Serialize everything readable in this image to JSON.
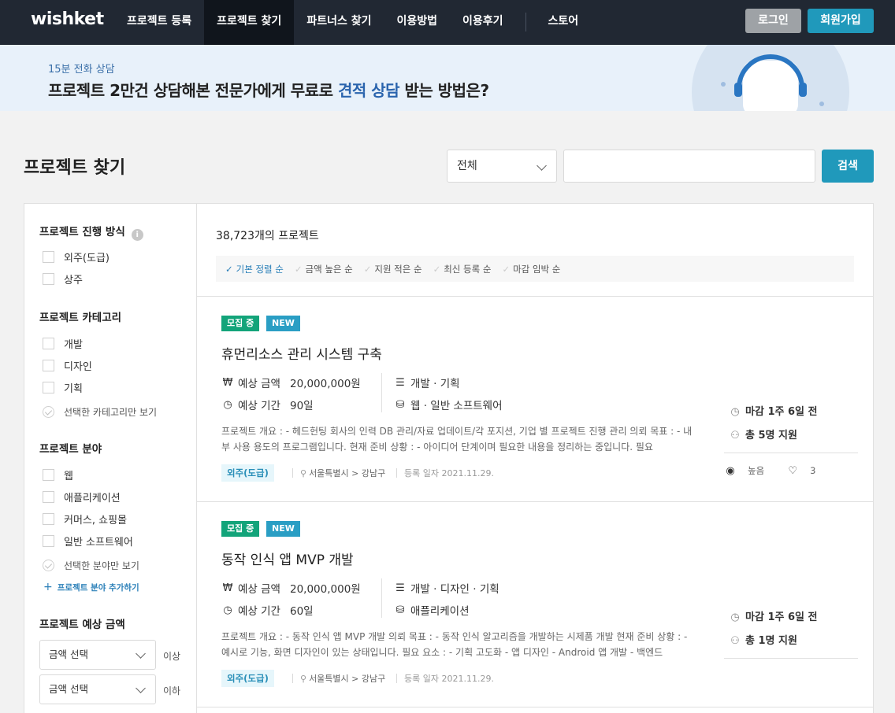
{
  "header": {
    "logo": "wishket",
    "nav": [
      "프로젝트 등록",
      "프로젝트 찾기",
      "파트너스 찾기",
      "이용방법",
      "이용후기",
      "스토어"
    ],
    "login": "로그인",
    "signup": "회원가입"
  },
  "banner": {
    "sub": "15분 전화 상담",
    "title_a": "프로젝트 2만건 상담해본 전문가에게 무료로 ",
    "title_hl": "견적 상담",
    "title_b": " 받는 방법은?"
  },
  "page": {
    "title": "프로젝트 찾기",
    "select_value": "전체",
    "search_placeholder": "",
    "search_button": "검색"
  },
  "sidebar": {
    "progress_title": "프로젝트 진행 방식",
    "progress_options": [
      "외주(도급)",
      "상주"
    ],
    "category_title": "프로젝트 카테고리",
    "category_options": [
      "개발",
      "디자인",
      "기획"
    ],
    "category_only": "선택한 카테고리만 보기",
    "field_title": "프로젝트 분야",
    "field_options": [
      "웹",
      "애플리케이션",
      "커머스, 쇼핑몰",
      "일반 소프트웨어"
    ],
    "field_only": "선택한 분야만 보기",
    "field_add": "프로젝트 분야 추가하기",
    "amount_title": "프로젝트 예상 금액",
    "amount_min": "금액 선택",
    "amount_min_suffix": "이상",
    "amount_max": "금액 선택",
    "amount_max_suffix": "이하"
  },
  "list": {
    "count": "38,723개의 프로젝트",
    "sorts": [
      "기본 정렬 순",
      "금액 높은 순",
      "지원 적은 순",
      "최신 등록 순",
      "마감 임박 순"
    ],
    "projects": [
      {
        "status": "모집 중",
        "new": "NEW",
        "title": "휴먼리소스 관리 시스템 구축",
        "budget_label": "예상 금액",
        "budget": "20,000,000원",
        "period_label": "예상 기간",
        "period": "90일",
        "category": "개발 · 기획",
        "field": "웹 · 일반 소프트웨어",
        "desc": "프로젝트 개요 : - 헤드헌팅 회사의 인력 DB 관리/자료 업데이트/각 포지션, 기업 별 프로젝트 진행 관리 의뢰 목표 : - 내부 사용 용도의 프로그램입니다. 현재 준비 상황 : - 아이디어 단계이며 필요한 내용을 정리하는 중입니다. 필요",
        "type": "외주(도급)",
        "location": "서울특별시 > 강남구",
        "registered": "등록 일자 2021.11.29.",
        "deadline": "마감 1주 6일 전",
        "applicants": "총 5명 지원",
        "views": "높음",
        "likes": "3"
      },
      {
        "status": "모집 중",
        "new": "NEW",
        "title": "동작 인식 앱 MVP 개발",
        "budget_label": "예상 금액",
        "budget": "20,000,000원",
        "period_label": "예상 기간",
        "period": "60일",
        "category": "개발 · 디자인 · 기획",
        "field": "애플리케이션",
        "desc": "프로젝트 개요 : - 동작 인식 앱 MVP 개발 의뢰 목표 : - 동작 인식 알고리즘을 개발하는 시제품 개발 현재 준비 상황 : - 예시로 기능, 화면 디자인이 있는 상태입니다. 필요 요소 : - 기획 고도화 - 앱 디자인 - Android 앱 개발 - 백엔드",
        "type": "외주(도급)",
        "location": "서울특별시 > 강남구",
        "registered": "등록 일자 2021.11.29.",
        "deadline": "마감 1주 6일 전",
        "applicants": "총 1명 지원"
      }
    ]
  }
}
